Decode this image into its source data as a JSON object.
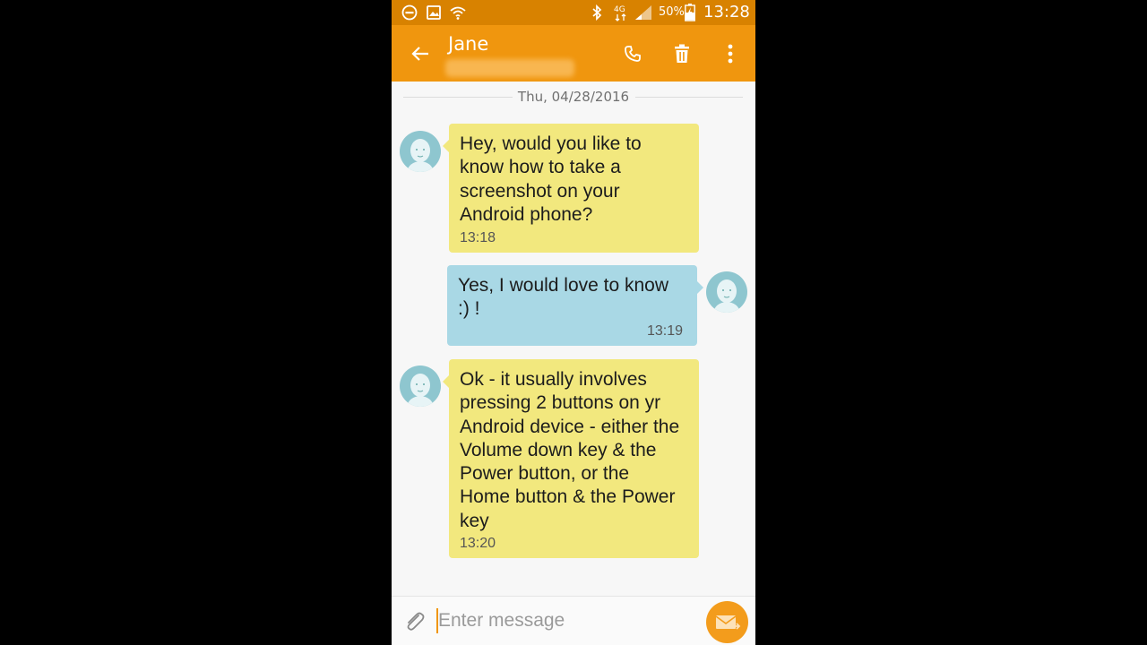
{
  "status_bar": {
    "battery_percent": "50%",
    "time": "13:28",
    "network": "4G",
    "icons": [
      "do-not-disturb-icon",
      "image-notification-icon",
      "wifi-icon",
      "bluetooth-icon",
      "network-4g-icon",
      "signal-icon",
      "battery-charging-icon"
    ]
  },
  "app_bar": {
    "contact_name": "Jane",
    "icons": [
      "back-arrow-icon",
      "phone-icon",
      "trash-icon",
      "more-vert-icon"
    ]
  },
  "conversation": {
    "date": "Thu, 04/28/2016",
    "messages": [
      {
        "direction": "incoming",
        "text": "Hey, would you like to\nknow how to take a\nscreenshot on your\nAndroid phone?",
        "time": "13:18"
      },
      {
        "direction": "outgoing",
        "text": "Yes, I would love to know\n:) !",
        "time": "13:19"
      },
      {
        "direction": "incoming",
        "text": "Ok - it usually involves\npressing 2 buttons on yr\nAndroid device - either the\nVolume down key & the\nPower button, or the\nHome button & the Power\nkey",
        "time": "13:20"
      }
    ]
  },
  "composer": {
    "placeholder": "Enter message",
    "value": "",
    "icons": [
      "paperclip-icon",
      "send-message-icon"
    ]
  },
  "colors": {
    "status_bar": "#d88200",
    "app_bar": "#f0960e",
    "incoming_bubble": "#f2e87e",
    "outgoing_bubble": "#a9d8e5",
    "avatar": "#8ec6cf",
    "send_button": "#f39c1c"
  }
}
